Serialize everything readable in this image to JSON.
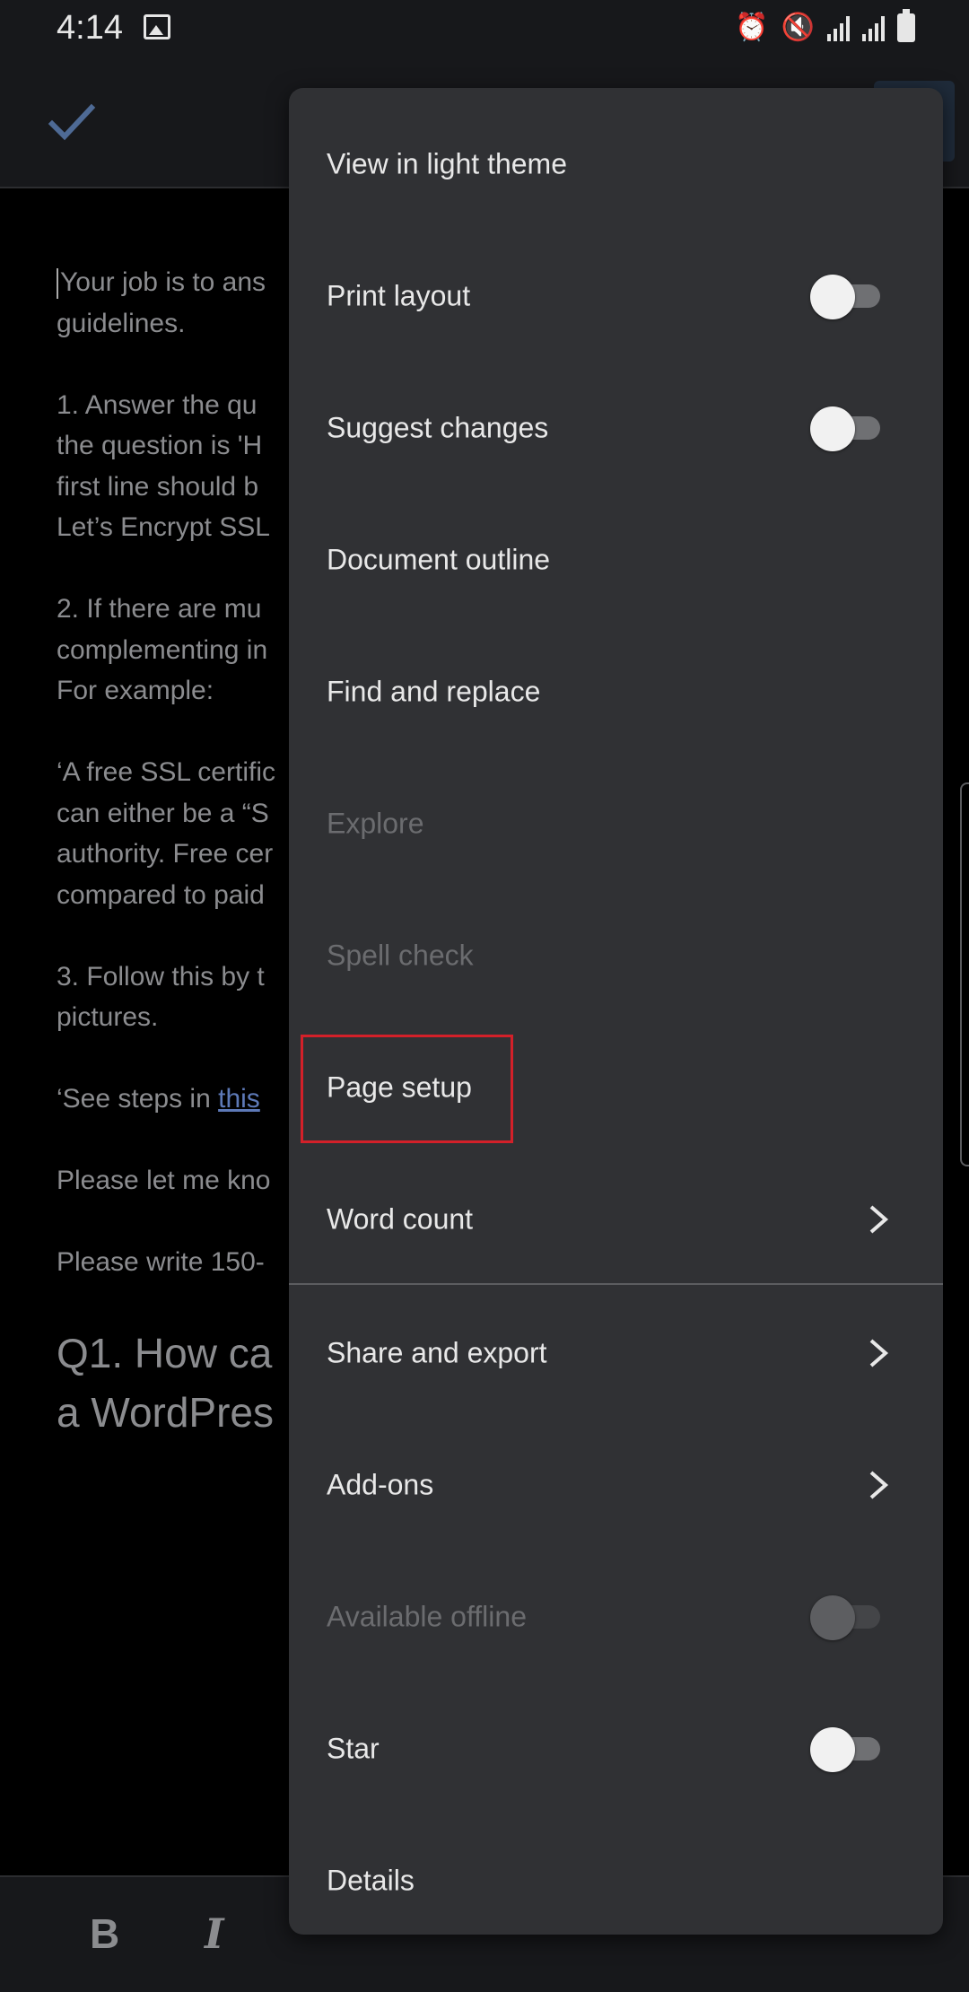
{
  "status_bar": {
    "time": "4:14",
    "icons": [
      "image-icon",
      "alarm-icon",
      "mute-icon",
      "signal-icon",
      "signal-icon",
      "battery-icon"
    ]
  },
  "toolbar": {
    "done_icon": "check-icon",
    "accent_color": "#4e6a95"
  },
  "document": {
    "paragraphs": [
      "Your job is to ans",
      "guidelines.",
      "1. Answer the qu",
      "the question is 'H",
      "first line should b",
      "Let’s Encrypt SSL",
      "2. If there are mu",
      "complementing in",
      "For example:",
      "‘A free SSL certific",
      "can either be a “S",
      "authority. Free cer",
      "compared to paid",
      "3. Follow this by t",
      "pictures.",
      "‘See steps in ",
      "this",
      "Please let me kno",
      "Please write 150-",
      "Q1. How ca",
      "a WordPres"
    ]
  },
  "menu": {
    "items": [
      {
        "label": "View in light theme",
        "type": "plain",
        "enabled": true
      },
      {
        "label": "Print layout",
        "type": "toggle",
        "enabled": true,
        "on": false
      },
      {
        "label": "Suggest changes",
        "type": "toggle",
        "enabled": true,
        "on": false
      },
      {
        "label": "Document outline",
        "type": "plain",
        "enabled": true
      },
      {
        "label": "Find and replace",
        "type": "plain",
        "enabled": true
      },
      {
        "label": "Explore",
        "type": "plain",
        "enabled": false
      },
      {
        "label": "Spell check",
        "type": "plain",
        "enabled": false
      },
      {
        "label": "Page setup",
        "type": "plain",
        "enabled": true,
        "highlighted": true
      },
      {
        "label": "Word count",
        "type": "submenu",
        "enabled": true
      },
      {
        "label": "Share and export",
        "type": "submenu",
        "enabled": true
      },
      {
        "label": "Add-ons",
        "type": "submenu",
        "enabled": true
      },
      {
        "label": "Available offline",
        "type": "toggle",
        "enabled": false,
        "on": false
      },
      {
        "label": "Star",
        "type": "toggle",
        "enabled": true,
        "on": false
      },
      {
        "label": "Details",
        "type": "plain",
        "enabled": true
      }
    ],
    "highlight_color": "#d32029"
  },
  "format_bar": {
    "bold": "B",
    "italic": "I"
  }
}
